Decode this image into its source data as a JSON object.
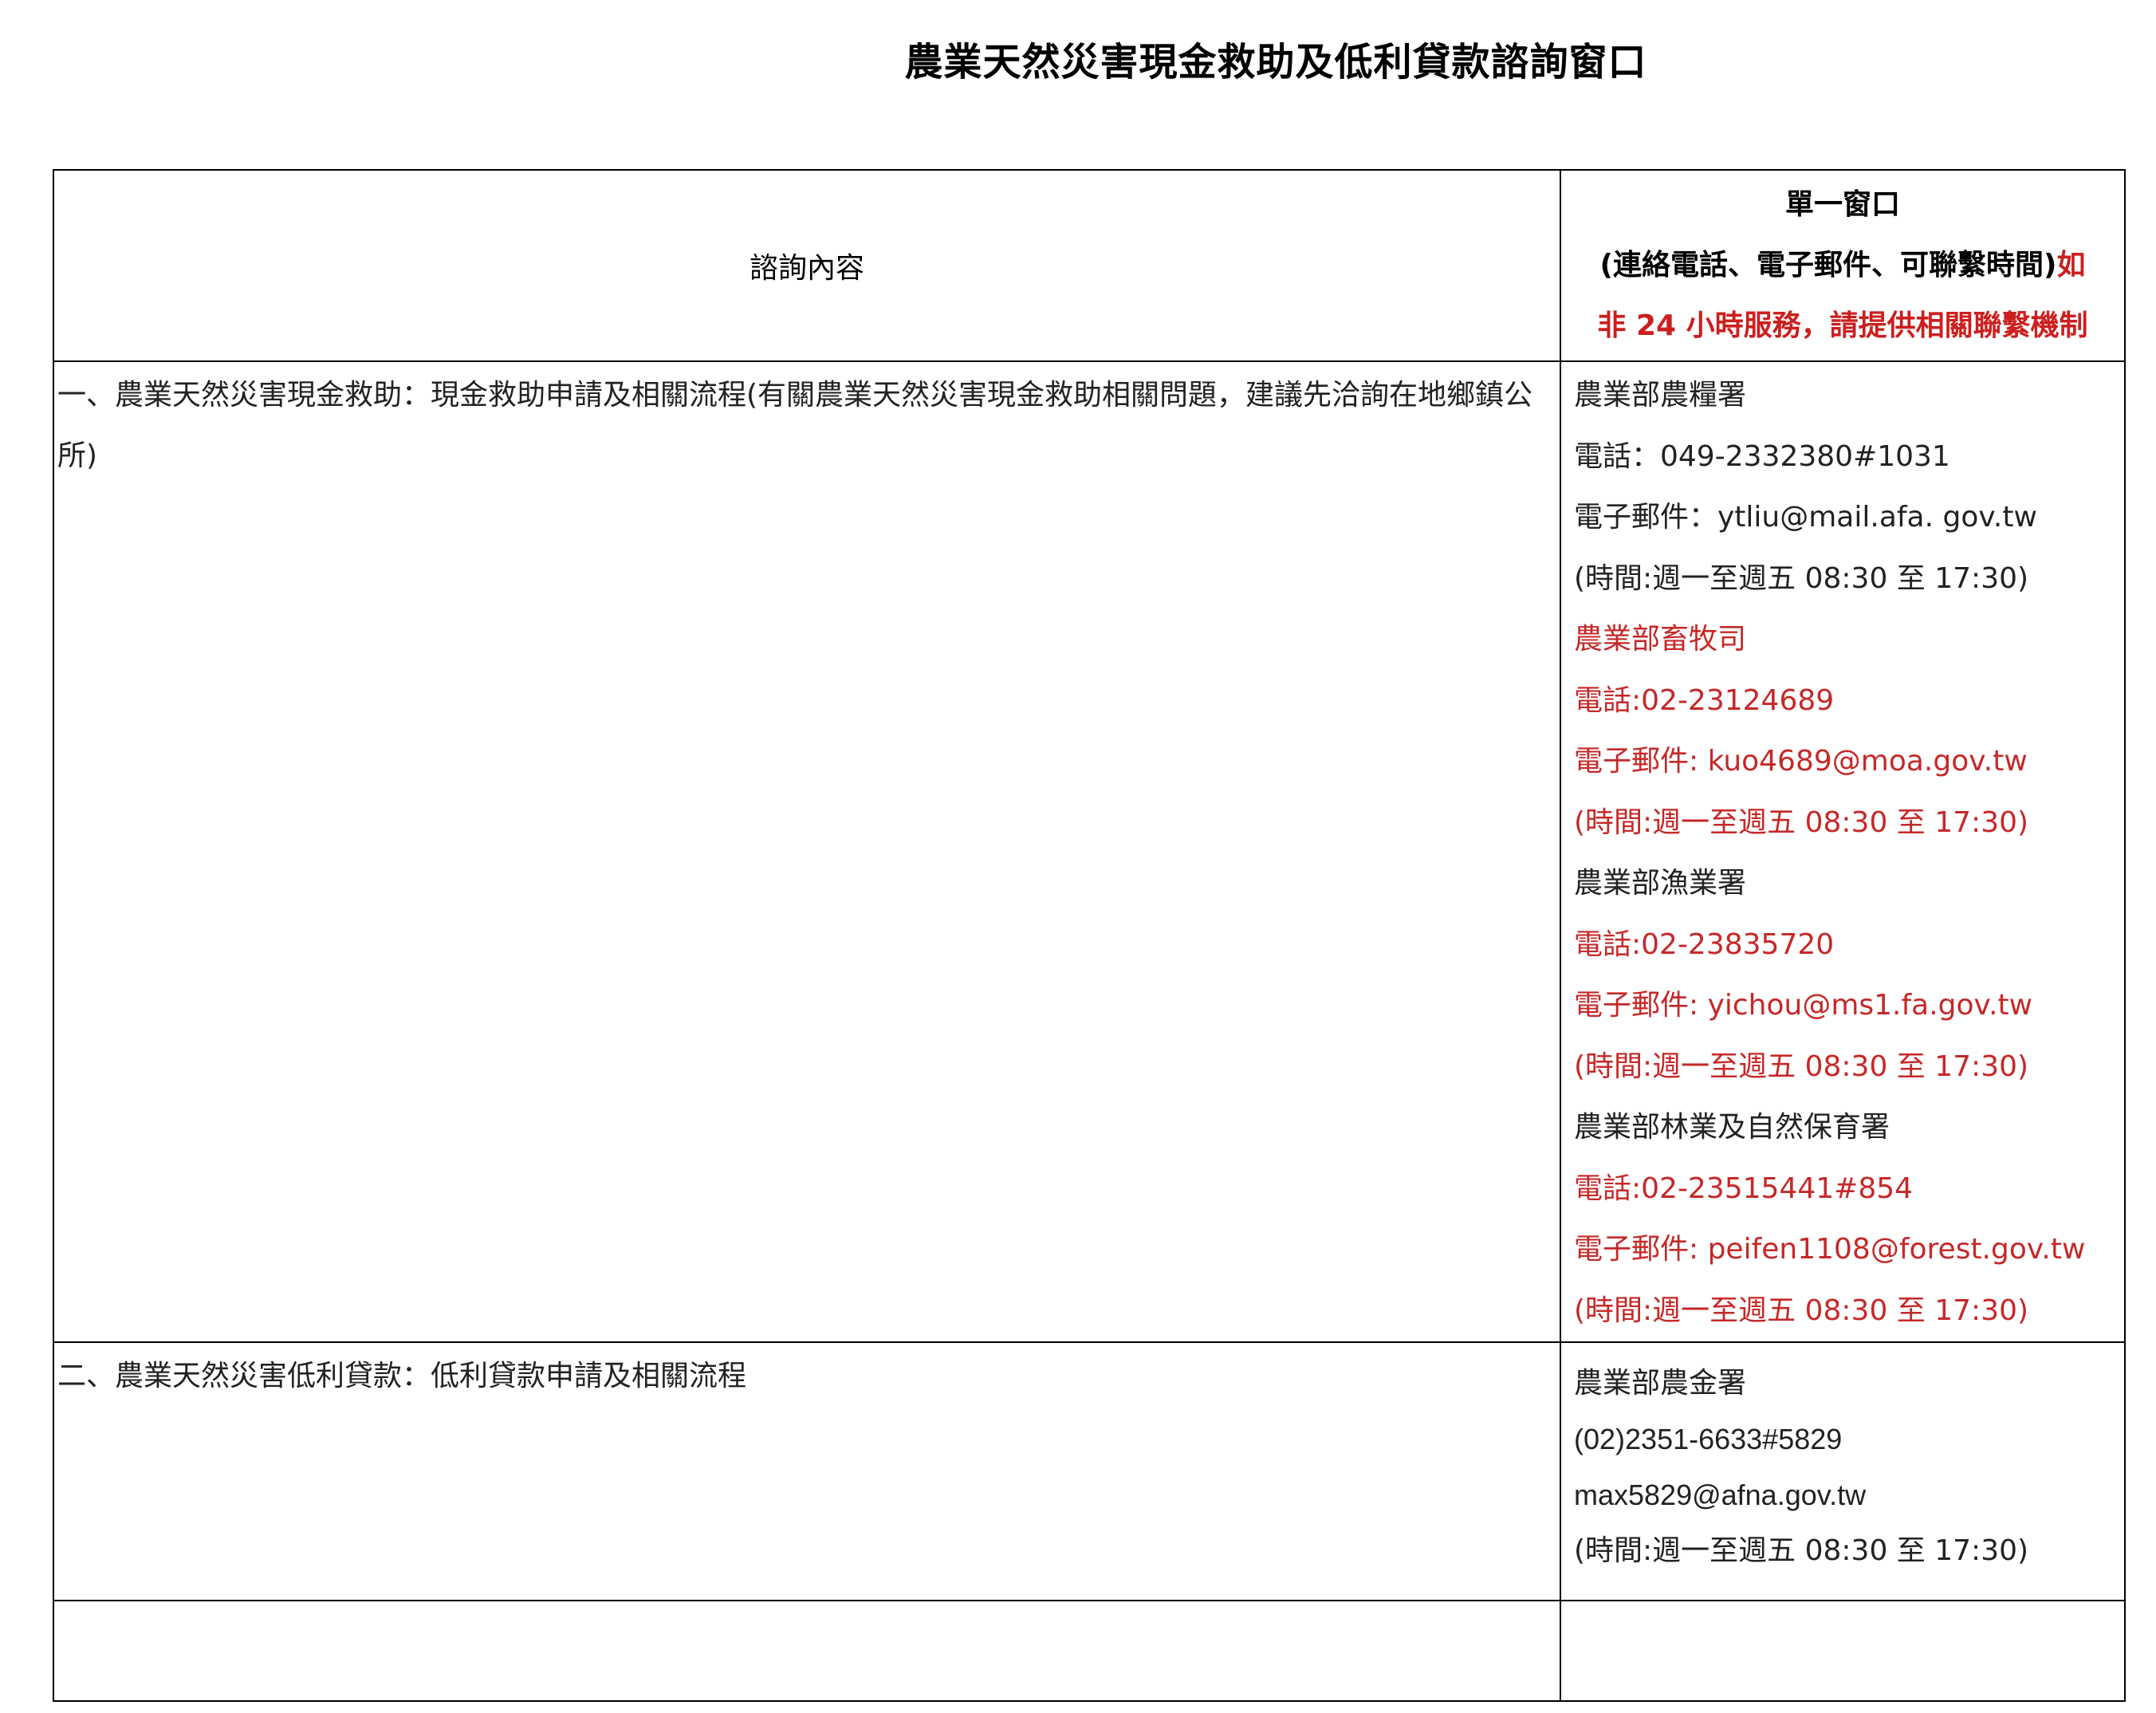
{
  "title": "農業天然災害現金救助及低利貸款諮詢窗口",
  "table": {
    "header": {
      "left": "諮詢內容",
      "right_line1": "單一窗口",
      "right_line2_black": "(連絡電話、電子郵件、可聯繫時間)",
      "right_line2_red": "如",
      "right_line3_red": "非 24 小時服務，請提供相關聯繫機制"
    },
    "rows": [
      {
        "topic": "一、農業天然災害現金救助：現金救助申請及相關流程(有關農業天然災害現金救助相關問題，建議先洽詢在地鄉鎮公所)",
        "contacts": [
          {
            "agency": "農業部農糧署",
            "phone": "電話：049-2332380#1031",
            "email": "電子郵件：ytliu@mail.afa. gov.tw",
            "hours": "(時間:週一至週五 08:30 至 17:30)"
          },
          {
            "agency": "農業部畜牧司",
            "phone": "電話:02-23124689",
            "email": "電子郵件: kuo4689@moa.gov.tw",
            "hours": "(時間:週一至週五 08:30 至 17:30)"
          },
          {
            "agency": "農業部漁業署",
            "phone": "電話:02-23835720",
            "email": "電子郵件: yichou@ms1.fa.gov.tw",
            "hours": "(時間:週一至週五 08:30 至 17:30)"
          },
          {
            "agency": "農業部林業及自然保育署",
            "phone": "電話:02-23515441#854",
            "email": "電子郵件: peifen1108@forest.gov.tw",
            "hours": "(時間:週一至週五 08:30 至 17:30)"
          }
        ]
      },
      {
        "topic": "二、農業天然災害低利貸款：低利貸款申請及相關流程",
        "contacts": [
          {
            "agency": "農業部農金署",
            "phone": "(02)2351-6633#5829",
            "email": "max5829@afna.gov.tw",
            "hours": "(時間:週一至週五 08:30 至 17:30)"
          }
        ]
      },
      {
        "topic": "",
        "contacts": []
      }
    ]
  },
  "colors": {
    "text": "#222222",
    "red": "#c62828",
    "border": "#000000"
  }
}
